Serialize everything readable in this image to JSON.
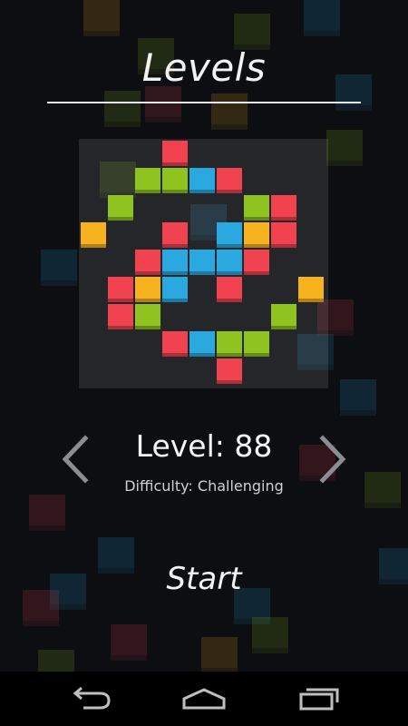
{
  "screen": {
    "title": "Levels",
    "level_label": "Level: 88",
    "difficulty_label": "Difficulty: Challenging",
    "start_label": "Start"
  },
  "colors": {
    "background": "#0c0e12",
    "red": "#f0424f",
    "green": "#8fc31f",
    "blue": "#2aa9e0",
    "orange": "#f7b21f"
  },
  "icons": {
    "prev": "chevron-left-icon",
    "next": "chevron-right-icon",
    "back": "back-icon",
    "home": "home-icon",
    "recent": "recent-apps-icon"
  },
  "level_pattern": {
    "grid_size": 9,
    "blocks": [
      {
        "row": 0,
        "col": 3,
        "color": "red"
      },
      {
        "row": 1,
        "col": 2,
        "color": "green"
      },
      {
        "row": 1,
        "col": 3,
        "color": "green"
      },
      {
        "row": 1,
        "col": 4,
        "color": "blue"
      },
      {
        "row": 1,
        "col": 5,
        "color": "red"
      },
      {
        "row": 2,
        "col": 1,
        "color": "green"
      },
      {
        "row": 2,
        "col": 6,
        "color": "green"
      },
      {
        "row": 2,
        "col": 7,
        "color": "red"
      },
      {
        "row": 3,
        "col": 0,
        "color": "orange"
      },
      {
        "row": 3,
        "col": 3,
        "color": "red"
      },
      {
        "row": 3,
        "col": 5,
        "color": "blue"
      },
      {
        "row": 3,
        "col": 6,
        "color": "orange"
      },
      {
        "row": 3,
        "col": 7,
        "color": "red"
      },
      {
        "row": 4,
        "col": 2,
        "color": "red"
      },
      {
        "row": 4,
        "col": 3,
        "color": "blue"
      },
      {
        "row": 4,
        "col": 4,
        "color": "blue"
      },
      {
        "row": 4,
        "col": 5,
        "color": "blue"
      },
      {
        "row": 4,
        "col": 6,
        "color": "red"
      },
      {
        "row": 5,
        "col": 1,
        "color": "red"
      },
      {
        "row": 5,
        "col": 2,
        "color": "orange"
      },
      {
        "row": 5,
        "col": 3,
        "color": "blue"
      },
      {
        "row": 5,
        "col": 5,
        "color": "red"
      },
      {
        "row": 5,
        "col": 8,
        "color": "orange"
      },
      {
        "row": 6,
        "col": 1,
        "color": "red"
      },
      {
        "row": 6,
        "col": 2,
        "color": "green"
      },
      {
        "row": 6,
        "col": 7,
        "color": "green"
      },
      {
        "row": 7,
        "col": 3,
        "color": "red"
      },
      {
        "row": 7,
        "col": 4,
        "color": "blue"
      },
      {
        "row": 7,
        "col": 5,
        "color": "green"
      },
      {
        "row": 7,
        "col": 6,
        "color": "green"
      },
      {
        "row": 8,
        "col": 5,
        "color": "red"
      }
    ]
  }
}
